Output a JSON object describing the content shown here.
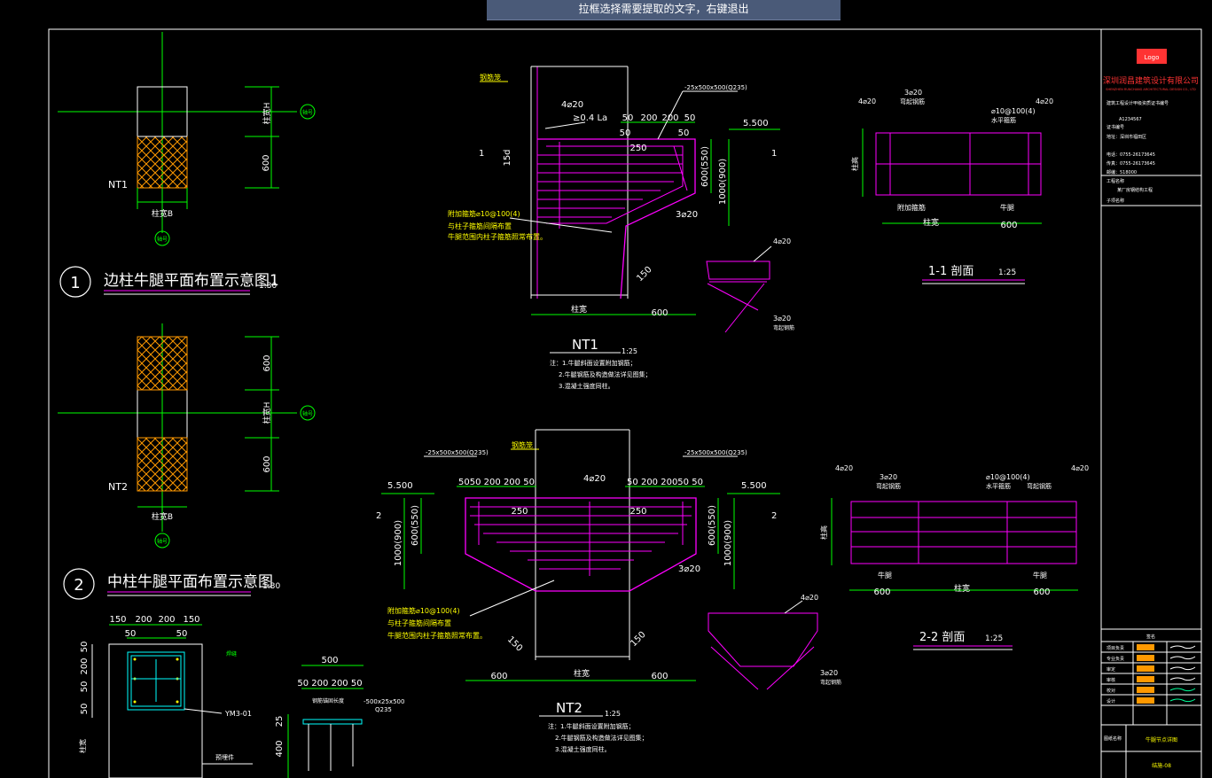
{
  "banner": {
    "text": "拉框选择需要提取的文字，右键退出"
  },
  "colors": {
    "white": "#ffffff",
    "green": "#00ff00",
    "magenta": "#ff00ff",
    "yellow": "#ffff00",
    "orange": "#ff9900",
    "red": "#ff3333"
  },
  "plan1": {
    "num": "1",
    "title": "边柱牛腿平面布置示意图1",
    "scale": "1:30",
    "tag": "NT1",
    "dim_top": "柱宽H",
    "dim_600": "600",
    "dim_b": "柱宽B",
    "axis": "轴号"
  },
  "plan2": {
    "num": "2",
    "title": "中柱牛腿平面布置示意图",
    "scale": "1:30",
    "tag": "NT2",
    "dim_top": "600",
    "dim_h": "柱宽H",
    "dim_600": "600",
    "dim_b": "柱宽B",
    "axis": "轴号"
  },
  "nt1": {
    "label": "NT1",
    "scale": "1:25",
    "hook": "≥0.4 La",
    "bar1": "4⌀20",
    "plate": "-25x500x500(Q235)",
    "elev": "5.500",
    "d50a": "50",
    "d200a": "200",
    "d200b": "200",
    "d50b": "50",
    "d50c": "50",
    "d250": "250",
    "d15": "15d",
    "dh": "600(550)",
    "dh2": "1000(900)",
    "bar3": "3⌀20",
    "d150": "150",
    "dw": "柱宽",
    "d600": "600",
    "stir": "附加箍筋⌀10@100(4)",
    "note_a": "与柱子箍筋间隔布置",
    "note_b": "牛腿范围内柱子箍筋照常布置。",
    "notes": [
      "注：1.牛腿斜面设置附加钢筋；",
      "2.牛腿钢筋及构造做法详见图集；",
      "3.混凝土强度同柱。"
    ],
    "tag": "钢筋笼",
    "sec": "1"
  },
  "det1": {
    "bar": "4⌀20",
    "bar3": "3⌀20",
    "lbl": "弯起钢筋"
  },
  "sec1": {
    "bar1": "4⌀20",
    "bar2": "3⌀20",
    "lbl2": "弯起钢筋",
    "bar3": "⌀10@100(4)",
    "lbl3": "水平箍筋",
    "bar4": "4⌀20",
    "lbl4": "纵向钢筋",
    "dw": "柱宽",
    "d600": "600",
    "ll": "附加箍筋",
    "rl": "牛腿",
    "title": "1-1 剖面",
    "scale": "1:25",
    "side": "柱高"
  },
  "nt2": {
    "label": "NT2",
    "scale": "1:25",
    "plate_l": "-25x500x500(Q235)",
    "plate_r": "-25x500x500(Q235)",
    "bar": "4⌀20",
    "elev_l": "5.500",
    "elev_r": "5.500",
    "dims_l": "5050 200  200  50",
    "dims_r": "50  200  20050 50",
    "d250a": "250",
    "d250b": "250",
    "dh": "600(550)",
    "dh2": "1000(900)",
    "bar3": "3⌀20",
    "d150a": "150",
    "d150b": "150",
    "d600a": "600",
    "dw": "柱宽",
    "d600b": "600",
    "stir": "附加箍筋⌀10@100(4)",
    "note_a": "与柱子箍筋间隔布置",
    "note_b": "牛腿范围内柱子箍筋照常布置。",
    "notes": [
      "注：1.牛腿斜面设置附加钢筋；",
      "2.牛腿钢筋及构造做法详见图集；",
      "3.混凝土强度同柱。"
    ],
    "sec": "2",
    "tag": "钢筋笼"
  },
  "sec2": {
    "bar1": "4⌀20",
    "bar2": "3⌀20",
    "lbl2": "弯起钢筋",
    "bar3": "⌀10@100(4)",
    "lbl3": "水平箍筋",
    "lbl3b": "弯起钢筋",
    "bar4": "4⌀20",
    "d600a": "600",
    "dw": "柱宽",
    "d600b": "600",
    "l1": "牛腿",
    "l2": "牛腿",
    "title": "2-2 剖面",
    "scale": "1:25",
    "side": "柱高"
  },
  "det2": {
    "bar": "4⌀20",
    "bar3": "3⌀20",
    "lbl": "弯起钢筋"
  },
  "embed": {
    "dims": [
      "150",
      "200",
      "200",
      "150"
    ],
    "d50a": "50",
    "d50b": "50",
    "v1": "50",
    "v2": "200",
    "v3": "50",
    "v4": "50",
    "tag": "YM3-01",
    "side": "柱宽",
    "lbl": "预埋件",
    "weld": "焊缝"
  },
  "embed2": {
    "d500": "500",
    "dims": "50 200  200 50",
    "plate": "-500x25x500",
    "q": "Q235",
    "v25": "25",
    "v400": "400",
    "lbl": "钢筋锚固长度"
  },
  "titleblock": {
    "logo": "Logo",
    "company": "深圳润昌建筑设计有限公司",
    "company_en": "SHENZHEN RUNCHANG ARCHITECTURAL DESIGN CO., LTD",
    "lines": [
      "建筑工程设计甲级资质证书编号",
      "A1234567",
      "证书编号",
      "地址：深圳市福田区",
      "电话：0755-26173645",
      "传真：0755-26173645",
      "邮编：518000"
    ],
    "proj": [
      "工程名称",
      "某厂房钢结构工程",
      "子项名称"
    ],
    "rows": [
      "项目负责",
      "专业负责",
      "审定",
      "审核",
      "校对",
      "设计"
    ],
    "sign": "签名",
    "drawing": "图纸名称",
    "drawing_name": "牛腿节点详图",
    "drawing_no": "结施-08"
  }
}
